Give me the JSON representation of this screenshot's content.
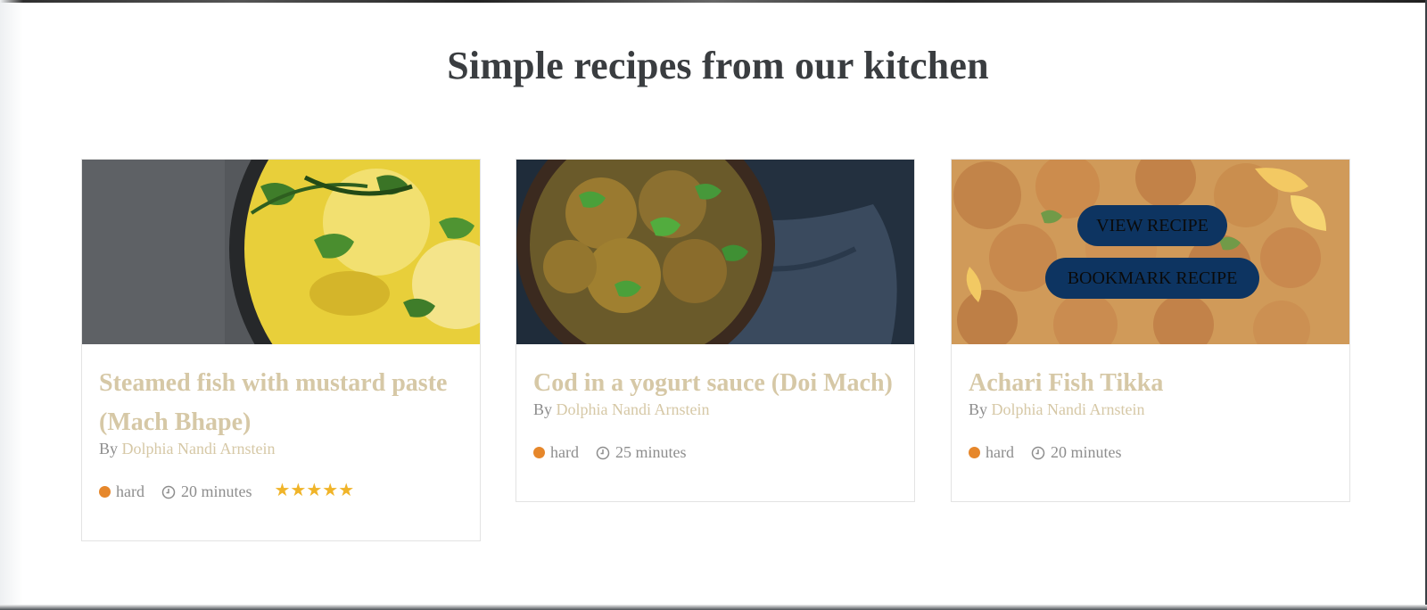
{
  "section": {
    "title": "Simple recipes from our kitchen"
  },
  "recipes": [
    {
      "title": "Steamed fish with mustard paste (Mach Bhape)",
      "by": "By",
      "author": "Dolphia Nandi Arnstein",
      "difficulty": "hard",
      "time": "20 minutes",
      "rating": 5,
      "stars": "★★★★★"
    },
    {
      "title": "Cod in a yogurt sauce (Doi Mach)",
      "by": "By",
      "author": "Dolphia Nandi Arnstein",
      "difficulty": "hard",
      "time": "25 minutes"
    },
    {
      "title": "Achari Fish Tikka",
      "by": "By",
      "author": "Dolphia Nandi Arnstein",
      "difficulty": "hard",
      "time": "20 minutes"
    }
  ],
  "overlay": {
    "view_label": "VIEW RECIPE",
    "bookmark_label": "BOOKMARK RECIPE"
  },
  "colors": {
    "title": "#3a3d40",
    "accent": "#d6c8a6",
    "meta": "#8d8d8d",
    "difficulty_dot": "#e6872b",
    "star": "#f0b429",
    "button_bg": "#0d3461"
  }
}
